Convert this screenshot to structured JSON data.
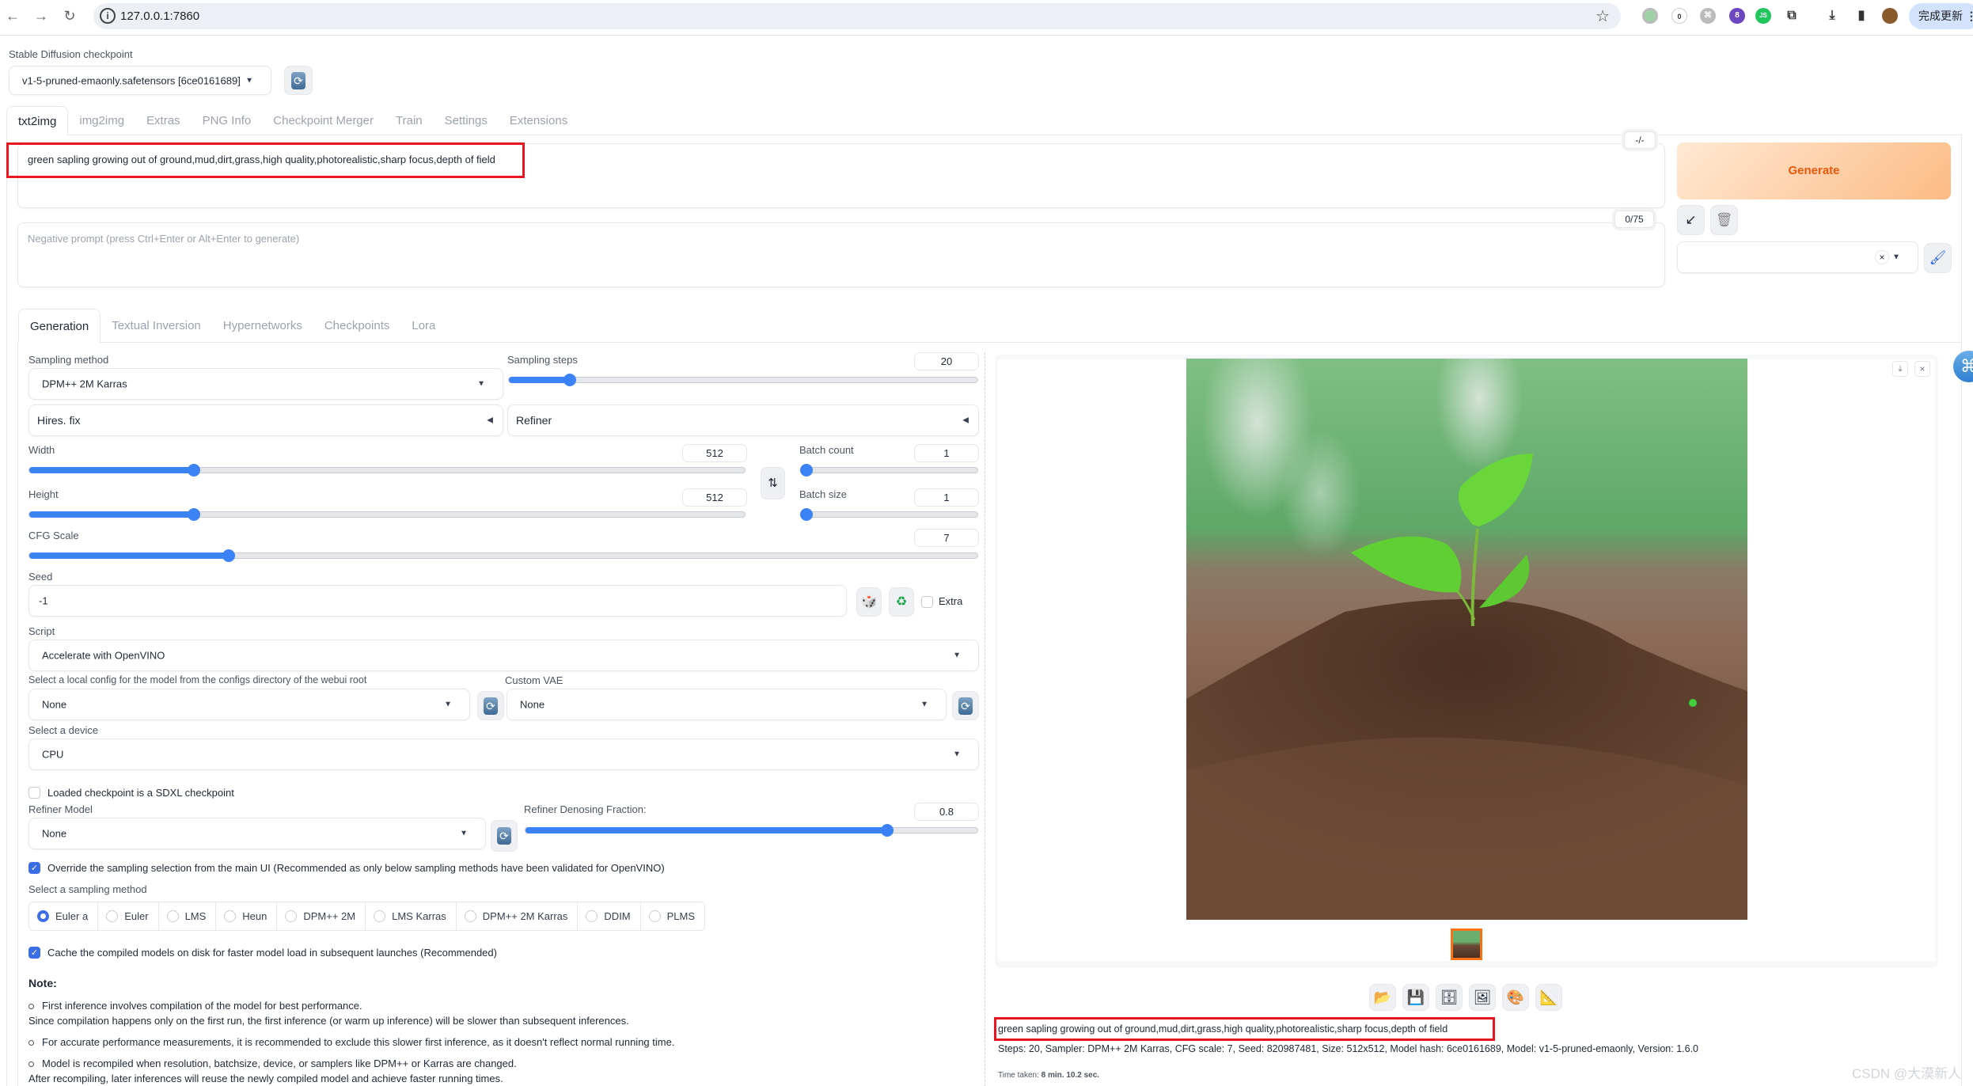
{
  "browser": {
    "url": "127.0.0.1:7860",
    "update_button_label": "完成更新",
    "extension_badges": [
      "0",
      "8"
    ],
    "extension_js_label": "JS"
  },
  "checkpoint": {
    "label": "Stable Diffusion checkpoint",
    "value": "v1-5-pruned-emaonly.safetensors [6ce0161689]"
  },
  "main_tabs": [
    "txt2img",
    "img2img",
    "Extras",
    "PNG Info",
    "Checkpoint Merger",
    "Train",
    "Settings",
    "Extensions"
  ],
  "active_main_tab": "txt2img",
  "prompt": {
    "value": "green sapling growing out of ground,mud,dirt,grass,high quality,photorealistic,sharp focus,depth of field",
    "token_counter": "-/-"
  },
  "negative_prompt": {
    "placeholder": "Negative prompt (press Ctrl+Enter or Alt+Enter to generate)",
    "token_counter": "0/75"
  },
  "actions": {
    "generate_label": "Generate",
    "styles_value": ""
  },
  "sub_tabs": [
    "Generation",
    "Textual Inversion",
    "Hypernetworks",
    "Checkpoints",
    "Lora"
  ],
  "active_sub_tab": "Generation",
  "generation": {
    "sampling_method_label": "Sampling method",
    "sampling_method_value": "DPM++ 2M Karras",
    "sampling_steps_label": "Sampling steps",
    "sampling_steps_value": "20",
    "sampling_steps_fraction": 0.13,
    "hires_fix_label": "Hires. fix",
    "refiner_label": "Refiner",
    "width_label": "Width",
    "width_value": "512",
    "width_fraction": 0.23,
    "height_label": "Height",
    "height_value": "512",
    "height_fraction": 0.23,
    "batch_count_label": "Batch count",
    "batch_count_value": "1",
    "batch_count_fraction": 0.0,
    "batch_size_label": "Batch size",
    "batch_size_value": "1",
    "batch_size_fraction": 0.0,
    "cfg_label": "CFG Scale",
    "cfg_value": "7",
    "cfg_fraction": 0.21,
    "seed_label": "Seed",
    "seed_value": "-1",
    "extra_label": "Extra"
  },
  "script": {
    "label": "Script",
    "value": "Accelerate with OpenVINO",
    "config_label": "Select a local config for the model from the configs directory of the webui root",
    "config_value": "None",
    "vae_label": "Custom VAE",
    "vae_value": "None",
    "device_label": "Select a device",
    "device_value": "CPU",
    "sdxl_label": "Loaded checkpoint is a SDXL checkpoint",
    "sdxl_checked": false,
    "refiner_model_label": "Refiner Model",
    "refiner_model_value": "None",
    "refiner_denoise_label": "Refiner Denosing Fraction:",
    "refiner_denoise_value": "0.8",
    "refiner_denoise_fraction": 0.8,
    "override_label": "Override the sampling selection from the main UI (Recommended as only below sampling methods have been validated for OpenVINO)",
    "override_checked": true,
    "sampler_select_label": "Select a sampling method",
    "samplers": [
      "Euler a",
      "Euler",
      "LMS",
      "Heun",
      "DPM++ 2M",
      "LMS Karras",
      "DPM++ 2M Karras",
      "DDIM",
      "PLMS"
    ],
    "selected_sampler": "Euler a",
    "cache_label": "Cache the compiled models on disk for faster model load in subsequent launches (Recommended)",
    "cache_checked": true
  },
  "note": {
    "title": "Note:",
    "lines": [
      "First inference involves compilation of the model for best performance.",
      "Since compilation happens only on the first run, the first inference (or warm up inference) will be slower than subsequent inferences.",
      "For accurate performance measurements, it is recommended to exclude this slower first inference, as it doesn't reflect normal running time.",
      "Model is recompiled when resolution, batchsize, device, or samplers like DPM++ or Karras are changed.",
      "After recompiling, later inferences will reuse the newly compiled model and achieve faster running times."
    ]
  },
  "output": {
    "image_alt": "green sapling growing out of soil",
    "gallery_buttons": [
      "open-folder",
      "save",
      "zip",
      "send-to-img2img",
      "send-to-inpaint",
      "send-to-extras"
    ],
    "prompt_text": "green sapling growing out of ground,mud,dirt,grass,high quality,photorealistic,sharp focus,depth of field",
    "params_text": "Steps: 20, Sampler: DPM++ 2M Karras, CFG scale: 7, Seed: 820987481, Size: 512x512, Model hash: 6ce0161689, Model: v1-5-pruned-emaonly, Version: 1.6.0",
    "time_label": "Time taken:",
    "time_value": "8 min. 10.2 sec."
  },
  "watermark": "CSDN @大漠新人",
  "colors": {
    "accent_blue": "#3b82f6",
    "generate_text": "#ea580c",
    "highlight_red": "#e8161f"
  }
}
